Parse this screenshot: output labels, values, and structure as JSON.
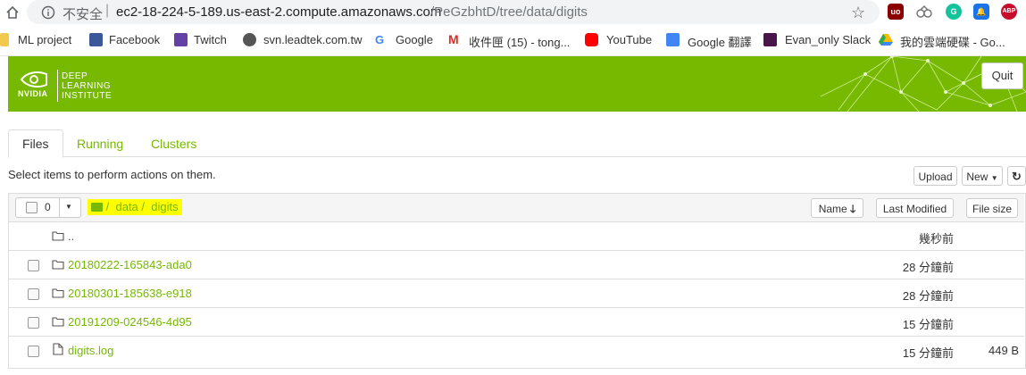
{
  "browser": {
    "insecure_label": "不安全",
    "url_separator": "|",
    "url_host": "ec2-18-224-5-189.us-east-2.compute.amazonaws.com",
    "url_path": "/PeGzbhtD/tree/data/digits",
    "extensions": [
      "uo-icon",
      "extension-icon",
      "grammarly-icon",
      "notification-icon",
      "abp-icon"
    ],
    "abp_label": "ABP"
  },
  "bookmarks": [
    {
      "label": "ML project",
      "icon": "folder-icon"
    },
    {
      "label": "Facebook",
      "icon": "facebook-icon"
    },
    {
      "label": "Twitch",
      "icon": "twitch-icon"
    },
    {
      "label": "svn.leadtek.com.tw",
      "icon": "globe-icon"
    },
    {
      "label": "Google",
      "icon": "google-icon"
    },
    {
      "label": "收件匣 (15) - tong...",
      "icon": "gmail-icon"
    },
    {
      "label": "YouTube",
      "icon": "youtube-icon"
    },
    {
      "label": "Google 翻譯",
      "icon": "translate-icon"
    },
    {
      "label": "Evan_only Slack",
      "icon": "slack-icon"
    },
    {
      "label": "我的雲端硬碟 - Go...",
      "icon": "drive-icon"
    }
  ],
  "header": {
    "brand_line1": "DEEP",
    "brand_line2": "LEARNING",
    "brand_line3": "INSTITUTE",
    "nvidia_word": "NVIDIA",
    "quit_label": "Quit",
    "color": "#76b900"
  },
  "tabs": [
    {
      "label": "Files",
      "active": true
    },
    {
      "label": "Running",
      "active": false
    },
    {
      "label": "Clusters",
      "active": false
    }
  ],
  "toolbar": {
    "select_message": "Select items to perform actions on them.",
    "upload_label": "Upload",
    "new_label": "New",
    "refresh_icon": "refresh-icon"
  },
  "list_header": {
    "selected_count": "0",
    "breadcrumb_sep1": "/",
    "breadcrumb_data": "data",
    "breadcrumb_sep2": "/",
    "breadcrumb_digits": "digits",
    "sort_name": "Name",
    "sort_modified": "Last Modified",
    "sort_size": "File size"
  },
  "items": [
    {
      "name": "..",
      "type": "folder",
      "modified": "幾秒前",
      "size": ""
    },
    {
      "name": "20180222-165843-ada0",
      "type": "folder",
      "modified": "28 分鐘前",
      "size": ""
    },
    {
      "name": "20180301-185638-e918",
      "type": "folder",
      "modified": "28 分鐘前",
      "size": ""
    },
    {
      "name": "20191209-024546-4d95",
      "type": "folder",
      "modified": "15 分鐘前",
      "size": ""
    },
    {
      "name": "digits.log",
      "type": "file",
      "modified": "15 分鐘前",
      "size": "449 B"
    }
  ]
}
